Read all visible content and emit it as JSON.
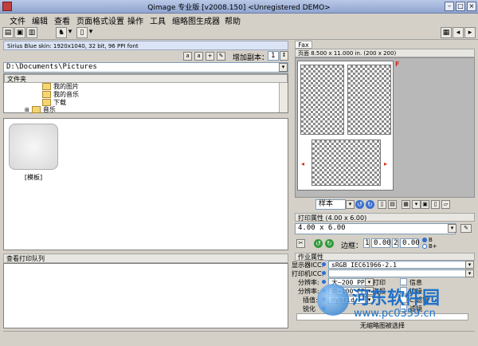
{
  "window": {
    "title": "Qimage 专业版 [v2008.150] <Unregistered DEMO>"
  },
  "menu": [
    "文件",
    "编辑",
    "查看",
    "页面格式设置",
    "操作",
    "工具",
    "缩略图生成器",
    "帮助"
  ],
  "status_top": "Sirius Blue skin: 1920x1040, 32 bit, 96 PPI font",
  "copies": {
    "label": "增加副本：",
    "value": "1"
  },
  "path": "D:\\Documents\\Pictures",
  "folders_header": "文件夹",
  "tree": [
    "我的图片",
    "我的音乐",
    "下载",
    "音乐"
  ],
  "thumbnail": {
    "caption": "[模板]"
  },
  "queue_header": "查看打印队列",
  "right": {
    "tab": "Fax",
    "page_info": "页面 8.500 x 11.000 in.  (200 x 200)",
    "sample_label": "样本",
    "print_props_header": "打印属性 (4.00 x 6.00)",
    "size_value": "4.00 x 6.00",
    "margin_label": "边框：",
    "margin_values": [
      "1",
      "0.00",
      "2",
      "0.00"
    ],
    "radio_b": "B",
    "radio_bplus": "B+",
    "job_header": "作业属性",
    "monitor_icc_label": "显示器ICC:",
    "monitor_icc_value": "sRGB IEC61966-2.1",
    "printer_icc_label": "打印机ICC:",
    "resolution_label_1": "分辨率:",
    "resolution_value_1": "大~200 PP",
    "print_label": "打印",
    "resolution_label_2": "分辨率:",
    "resolution_value_2": "高~100 PP",
    "poster_label": "海报",
    "interp_label": "插值:",
    "interp_value": "Hybrid",
    "sharpen_label": "锐化",
    "opt_1": "信息",
    "opt_2": "边缘",
    "opt_3": "C.滤镜",
    "opt_4": "滤镜",
    "bottom_note": "无缩略图被选择"
  },
  "watermark": {
    "cn": "河东软件园",
    "url": "www.pc0359.cn"
  }
}
